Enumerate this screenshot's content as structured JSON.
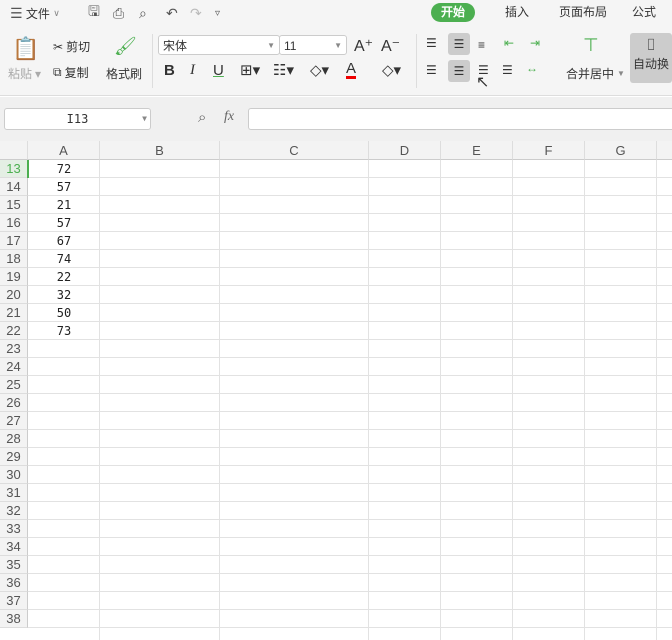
{
  "menu": {
    "file": "文件",
    "tabs": [
      "开始",
      "插入",
      "页面布局",
      "公式"
    ]
  },
  "ribbon": {
    "paste": "粘贴",
    "cut": "剪切",
    "copy": "复制",
    "format_painter": "格式刷",
    "font_name": "宋体",
    "font_size": "11",
    "merge_center": "合并居中",
    "wrap_text": "自动换"
  },
  "formula_bar": {
    "cell_ref": "I13",
    "fx": "fx",
    "value": ""
  },
  "columns": [
    "A",
    "B",
    "C",
    "D",
    "E",
    "F",
    "G"
  ],
  "rows": [
    13,
    14,
    15,
    16,
    17,
    18,
    19,
    20,
    21,
    22,
    23,
    24,
    25,
    26,
    27,
    28,
    29,
    30,
    31,
    32,
    33,
    34,
    35,
    36,
    37,
    38
  ],
  "colA_values": [
    "72",
    "57",
    "21",
    "57",
    "67",
    "74",
    "22",
    "32",
    "50",
    "73"
  ],
  "colors": {
    "accent": "#4caf50"
  }
}
